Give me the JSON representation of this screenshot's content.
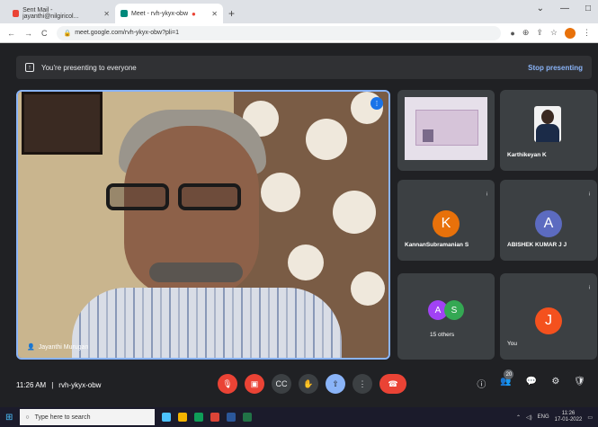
{
  "browser": {
    "tabs": [
      {
        "label": "Sent Mail - jayanthi@nilgiricol...",
        "active": false
      },
      {
        "label": "Meet - rvh-ykyx-obw",
        "active": true
      }
    ],
    "url": "meet.google.com/rvh-ykyx-obw?pli=1"
  },
  "banner": {
    "text": "You're presenting to everyone",
    "stop_label": "Stop presenting"
  },
  "main_speaker": {
    "name": "Jayanthi Murugan"
  },
  "participants": [
    {
      "name": "",
      "type": "presentation"
    },
    {
      "name": "Karthikeyan K",
      "type": "video"
    },
    {
      "name": "KannanSubramanian S",
      "initial": "K",
      "color": "#e8710a"
    },
    {
      "name": "ABISHEK KUMAR J J",
      "initial": "A",
      "color": "#5c6bc0"
    },
    {
      "name": "15 others",
      "initials": [
        "A",
        "S"
      ],
      "colors": [
        "#a142f4",
        "#34a853"
      ]
    },
    {
      "name": "You",
      "initial": "J",
      "color": "#f4511e"
    }
  ],
  "footer": {
    "time": "11:26 AM",
    "separator": "|",
    "meeting_code": "rvh-ykyx-obw",
    "people_count": "20"
  },
  "taskbar": {
    "search_placeholder": "Type here to search",
    "lang": "ENG",
    "clock_time": "11:26",
    "clock_date": "17-01-2022"
  }
}
